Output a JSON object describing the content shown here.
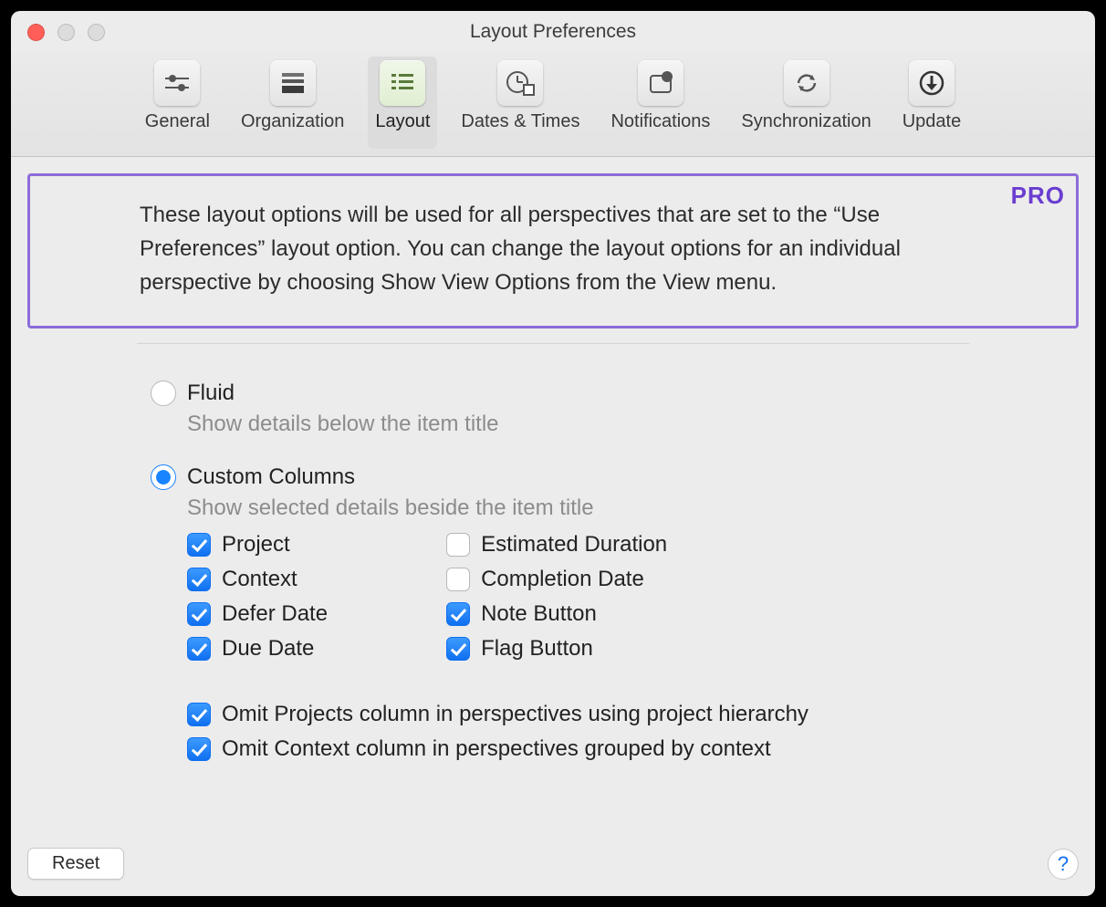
{
  "title": "Layout Preferences",
  "toolbar": [
    {
      "label": "General"
    },
    {
      "label": "Organization"
    },
    {
      "label": "Layout"
    },
    {
      "label": "Dates & Times"
    },
    {
      "label": "Notifications"
    },
    {
      "label": "Synchronization"
    },
    {
      "label": "Update"
    }
  ],
  "pro_badge": "PRO",
  "intro_text": "These layout options will be used for all perspectives that are set to the “Use Preferences” layout option. You can change the layout options for an individual perspective by choosing Show View Options from the View menu.",
  "layout_modes": {
    "fluid": {
      "label": "Fluid",
      "desc": "Show details below the item title",
      "selected": false
    },
    "custom": {
      "label": "Custom Columns",
      "desc": "Show selected details beside the item title",
      "selected": true
    }
  },
  "columns": {
    "left": [
      {
        "label": "Project",
        "checked": true
      },
      {
        "label": "Context",
        "checked": true
      },
      {
        "label": "Defer Date",
        "checked": true
      },
      {
        "label": "Due Date",
        "checked": true
      }
    ],
    "right": [
      {
        "label": "Estimated Duration",
        "checked": false
      },
      {
        "label": "Completion Date",
        "checked": false
      },
      {
        "label": "Note Button",
        "checked": true
      },
      {
        "label": "Flag Button",
        "checked": true
      }
    ]
  },
  "omit": [
    {
      "label": "Omit Projects column in perspectives using project hierarchy",
      "checked": true
    },
    {
      "label": "Omit Context column in perspectives grouped by context",
      "checked": true
    }
  ],
  "footer": {
    "reset_label": "Reset",
    "help_label": "?"
  }
}
